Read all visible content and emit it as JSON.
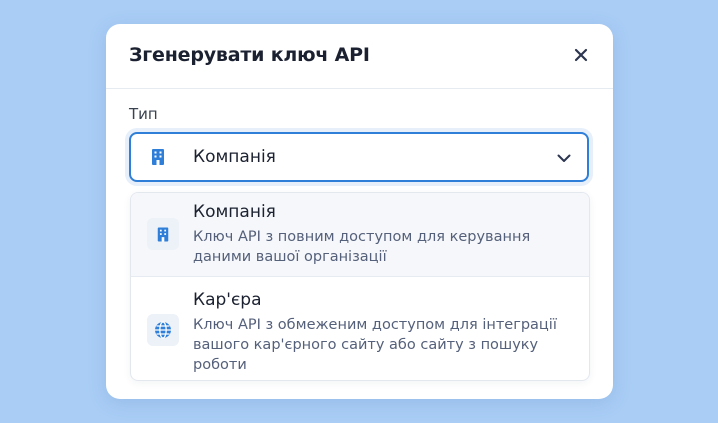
{
  "dialog": {
    "title": "Згенерувати ключ API",
    "close_icon": "close-icon"
  },
  "type_field": {
    "label": "Тип",
    "selected_value": "Компанія",
    "selected_icon": "building-icon",
    "accent_color": "#2f7fd8"
  },
  "options": [
    {
      "title": "Компанія",
      "description": "Ключ API з повним доступом для керування даними вашої організації",
      "icon": "building-icon",
      "selected": true
    },
    {
      "title": "Кар'єра",
      "description": "Ключ API з обмеженим доступом для інтеграції вашого кар'єрного сайту або сайту з пошуку роботи",
      "icon": "globe-icon",
      "selected": false
    }
  ]
}
